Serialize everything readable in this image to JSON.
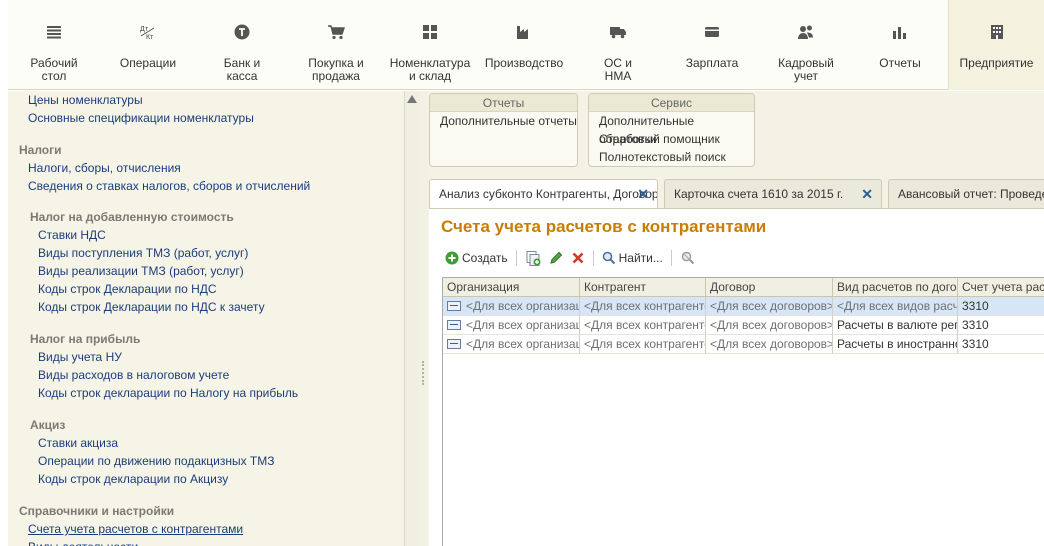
{
  "sections": [
    {
      "name": "section-desktop",
      "icon": "list-icon",
      "label": "Рабочий стол",
      "lines": [
        "Рабочий",
        "стол"
      ]
    },
    {
      "name": "section-operations",
      "icon": "debit-credit-icon",
      "label": "Операции",
      "lines": [
        "Операции"
      ]
    },
    {
      "name": "section-bank",
      "icon": "currency-icon",
      "label": "Банк и касса",
      "lines": [
        "Банк и",
        "касса"
      ]
    },
    {
      "name": "section-purchase",
      "icon": "cart-icon",
      "label": "Покупка и продажа",
      "lines": [
        "Покупка и",
        "продажа"
      ]
    },
    {
      "name": "section-nomenclature",
      "icon": "grid-icon",
      "label": "Номенклатура и склад",
      "lines": [
        "Номенклатура",
        "и склад"
      ]
    },
    {
      "name": "section-production",
      "icon": "factory-icon",
      "label": "Производство",
      "lines": [
        "Производство"
      ]
    },
    {
      "name": "section-fixed-assets",
      "icon": "truck-icon",
      "label": "ОС и НМА",
      "lines": [
        "ОС и",
        "НМА"
      ]
    },
    {
      "name": "section-salary",
      "icon": "wallet-icon",
      "label": "Зарплата",
      "lines": [
        "Зарплата"
      ]
    },
    {
      "name": "section-hr",
      "icon": "people-icon",
      "label": "Кадровый учет",
      "lines": [
        "Кадровый",
        "учет"
      ]
    },
    {
      "name": "section-reports",
      "icon": "bar-chart-icon",
      "label": "Отчеты",
      "lines": [
        "Отчеты"
      ]
    },
    {
      "name": "section-enterprise",
      "icon": "building-icon",
      "label": "Предприятие",
      "lines": [
        "Предприятие"
      ]
    }
  ],
  "nav": [
    {
      "type": "link",
      "text": "Цены номенклатуры"
    },
    {
      "type": "link",
      "text": "Основные спецификации номенклатуры"
    },
    {
      "type": "head",
      "text": "Налоги"
    },
    {
      "type": "link",
      "text": "Налоги, сборы, отчисления"
    },
    {
      "type": "link",
      "text": "Сведения о ставках налогов, сборов и отчислений"
    },
    {
      "type": "head",
      "text": "Налог на добавленную стоимость"
    },
    {
      "type": "link",
      "text": "Ставки НДС"
    },
    {
      "type": "link",
      "text": "Виды поступления ТМЗ (работ, услуг)"
    },
    {
      "type": "link",
      "text": "Виды реализации ТМЗ (работ, услуг)"
    },
    {
      "type": "link",
      "text": "Коды строк Декларации по НДС"
    },
    {
      "type": "link",
      "text": "Коды строк Декларации по НДС к зачету"
    },
    {
      "type": "head",
      "text": "Налог на прибыль"
    },
    {
      "type": "link",
      "text": "Виды учета НУ"
    },
    {
      "type": "link",
      "text": "Виды расходов в налоговом учете"
    },
    {
      "type": "link",
      "text": "Коды строк декларации по Налогу на прибыль"
    },
    {
      "type": "head",
      "text": "Акциз"
    },
    {
      "type": "link",
      "text": "Ставки акциза"
    },
    {
      "type": "link",
      "text": "Операции по движению подакцизных ТМЗ"
    },
    {
      "type": "link",
      "text": "Коды строк декларации по Акцизу"
    },
    {
      "type": "head",
      "text": "Справочники и настройки"
    },
    {
      "type": "link",
      "text": "Счета учета расчетов с контрагентами"
    },
    {
      "type": "link",
      "text": "Виды деятельности"
    }
  ],
  "panels": {
    "reports": {
      "title": "Отчеты",
      "items": [
        "Дополнительные отчеты"
      ]
    },
    "service": {
      "title": "Сервис",
      "items": [
        "Дополнительные обработки",
        "Стартовый помощник",
        "Полнотекстовый поиск"
      ]
    }
  },
  "tabs": [
    {
      "label": "Анализ субконто Контрагенты, Договоры"
    },
    {
      "label": "Карточка счета 1610  за 2015 г."
    },
    {
      "label": "Авансовый отчет: Проведен"
    }
  ],
  "page_title": "Счета учета расчетов с контрагентами",
  "toolbar": {
    "create": "Создать",
    "find": "Найти..."
  },
  "grid": {
    "columns": [
      "Организация",
      "Контрагент",
      "Договор",
      "Вид расчетов по договору",
      "Счет учета расчетов"
    ],
    "rows": [
      {
        "selected": true,
        "cells": [
          "<Для всех организаций>",
          "<Для всех контрагентов>",
          "<Для всех договоров>",
          "<Для всех видов расчетов>",
          "3310"
        ]
      },
      {
        "selected": false,
        "cells": [
          "<Для всех организаций>",
          "<Для всех контрагентов>",
          "<Для всех договоров>",
          "Расчеты в валюте регламентированного учета",
          "3310"
        ]
      },
      {
        "selected": false,
        "cells": [
          "<Для всех организаций>",
          "<Для всех контрагентов>",
          "<Для всех договоров>",
          "Расчеты в иностранной валюте",
          "3310"
        ]
      }
    ]
  },
  "colors": {
    "accent": "#c87d00",
    "link": "#1b3d7a",
    "selection": "#d6e6f6"
  }
}
